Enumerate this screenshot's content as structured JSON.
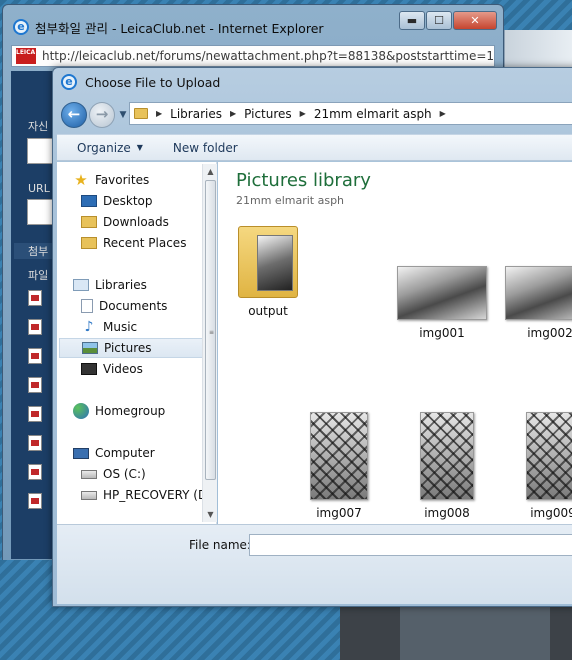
{
  "ie": {
    "title": "첨부화일 관리 - LeicaClub.net - Internet Explorer",
    "url": "http://leicaclub.net/forums/newattachment.php?t=88138&poststarttime=1500718250",
    "logo_text": "LEICA CLUB",
    "min_glyph": "▬",
    "max_glyph": "☐",
    "close_glyph": "✕",
    "side_labels": [
      "자신",
      "URL",
      "첨부",
      "파일"
    ]
  },
  "dialog": {
    "title": "Choose File to Upload",
    "breadcrumb": [
      "Libraries",
      "Pictures",
      "21mm elmarit asph"
    ],
    "toolbar": {
      "organize": "Organize",
      "new_folder": "New folder"
    },
    "nav": {
      "favorites": "Favorites",
      "desktop": "Desktop",
      "downloads": "Downloads",
      "recent": "Recent Places",
      "libraries": "Libraries",
      "documents": "Documents",
      "music": "Music",
      "pictures": "Pictures",
      "videos": "Videos",
      "homegroup": "Homegroup",
      "computer": "Computer",
      "os_drive": "OS (C:)",
      "recovery": "HP_RECOVERY (D"
    },
    "content": {
      "title": "Pictures library",
      "subtitle": "21mm elmarit asph",
      "items": [
        "output",
        "img001",
        "img002",
        "img007",
        "img008",
        "img009"
      ]
    },
    "file_name_label": "File name:",
    "file_name_value": ""
  }
}
